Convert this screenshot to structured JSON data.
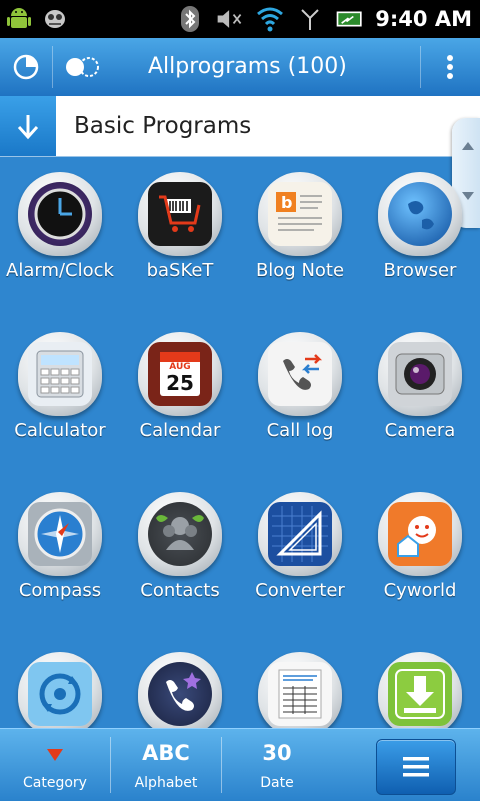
{
  "status": {
    "time": "9:40 AM"
  },
  "header": {
    "title": "Allprograms (100)"
  },
  "category": {
    "label": "Basic Programs"
  },
  "apps": [
    {
      "label": "Alarm/Clock",
      "icon": "clock-icon"
    },
    {
      "label": "baSKeT",
      "icon": "basket-icon"
    },
    {
      "label": "Blog Note",
      "icon": "blog-note-icon"
    },
    {
      "label": "Browser",
      "icon": "globe-icon"
    },
    {
      "label": "Calculator",
      "icon": "calculator-icon"
    },
    {
      "label": "Calendar",
      "icon": "calendar-icon",
      "day_month": "AUG",
      "day_number": "25"
    },
    {
      "label": "Call log",
      "icon": "call-log-icon"
    },
    {
      "label": "Camera",
      "icon": "camera-icon"
    },
    {
      "label": "Compass",
      "icon": "compass-icon"
    },
    {
      "label": "Contacts",
      "icon": "contacts-icon"
    },
    {
      "label": "Converter",
      "icon": "converter-icon"
    },
    {
      "label": "Cyworld",
      "icon": "cyworld-icon"
    },
    {
      "label": "",
      "icon": "sync-icon"
    },
    {
      "label": "",
      "icon": "phone-icon"
    },
    {
      "label": "",
      "icon": "document-icon"
    },
    {
      "label": "",
      "icon": "download-icon"
    }
  ],
  "bottom": {
    "category_label": "Category",
    "alphabet_top": "ABC",
    "alphabet_label": "Alphabet",
    "date_top": "30",
    "date_label": "Date"
  },
  "colors": {
    "background": "#2f86cf",
    "title_bar": "#1f73c2",
    "accent_red": "#e33a1a"
  }
}
